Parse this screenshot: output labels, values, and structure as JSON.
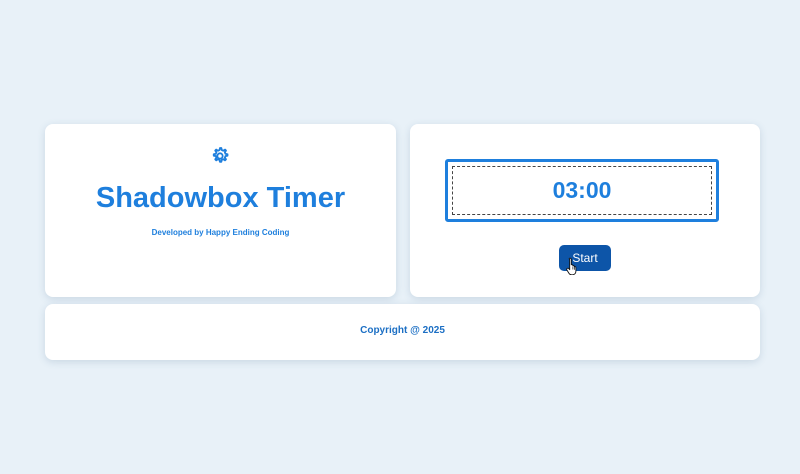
{
  "header": {
    "title": "Shadowbox Timer",
    "subtitle": "Developed by Happy Ending Coding",
    "settings_icon": "gear-icon"
  },
  "timer": {
    "display": "03:00",
    "start_label": "Start"
  },
  "footer": {
    "copyright": "Copyright @ 2025"
  },
  "colors": {
    "background": "#e8f1f8",
    "accent": "#1e7fdd",
    "button": "#0d55a8"
  }
}
